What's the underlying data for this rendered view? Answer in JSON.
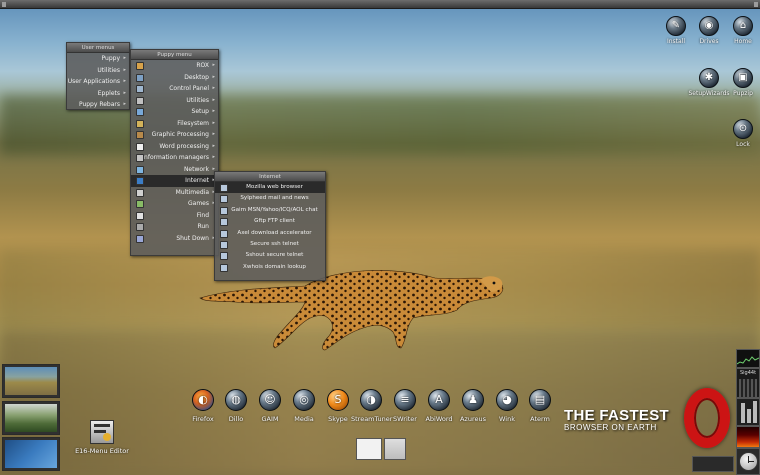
{
  "desktop": {
    "top_icons": [
      {
        "label": "Install",
        "icon": "install-icon",
        "glyph": "✎"
      },
      {
        "label": "Drives",
        "icon": "drives-icon",
        "glyph": "◉"
      },
      {
        "label": "Home",
        "icon": "home-icon",
        "glyph": "⌂"
      },
      {
        "label": "SetupWizards",
        "icon": "wizard-icon",
        "glyph": "✱"
      },
      {
        "label": "Pupzip",
        "icon": "pupzip-icon",
        "glyph": "▣"
      },
      {
        "label": "Lock",
        "icon": "lock-icon",
        "glyph": "⊙"
      }
    ],
    "menu_editor_label": "E16-Menu Editor"
  },
  "menus": {
    "user_menus": {
      "title": "User menus",
      "items": [
        "Puppy",
        "Utilities",
        "User Applications",
        "Epplets",
        "Puppy Rebars"
      ]
    },
    "puppy_menu": {
      "title": "Puppy menu",
      "items": [
        {
          "label": "ROX",
          "sub": true
        },
        {
          "label": "Desktop",
          "sub": true
        },
        {
          "label": "Control Panel",
          "sub": true
        },
        {
          "label": "Utilities",
          "sub": true
        },
        {
          "label": "Setup",
          "sub": true
        },
        {
          "label": "Filesystem",
          "sub": true
        },
        {
          "label": "Graphic Processing",
          "sub": true
        },
        {
          "label": "Word processing",
          "sub": true
        },
        {
          "label": "Information managers",
          "sub": true
        },
        {
          "label": "Network",
          "sub": true
        },
        {
          "label": "Internet",
          "sub": true
        },
        {
          "label": "Multimedia",
          "sub": true
        },
        {
          "label": "Games",
          "sub": true
        },
        {
          "label": "Find",
          "sub": false
        },
        {
          "label": "Run",
          "sub": false
        },
        {
          "label": "Shut Down",
          "sub": true
        }
      ]
    },
    "internet_menu": {
      "title": "Internet",
      "items": [
        "Mozilla web browser",
        "Sylpheed mail and news",
        "Gaim MSN/Yahoo/ICQ/AOL chat",
        "Gftp FTP client",
        "Axel download accelerator",
        "Secure ssh telnet",
        "Sshout secure telnet",
        "Xwhois domain lookup"
      ]
    }
  },
  "dock": {
    "items": [
      {
        "label": "Firefox",
        "icon": "firefox-icon",
        "glyph": "◐"
      },
      {
        "label": "Dillo",
        "icon": "dillo-icon",
        "glyph": "◍"
      },
      {
        "label": "GAIM",
        "icon": "gaim-icon",
        "glyph": "☺"
      },
      {
        "label": "Media",
        "icon": "media-icon",
        "glyph": "◎"
      },
      {
        "label": "Skype",
        "icon": "skype-icon",
        "glyph": "S"
      },
      {
        "label": "StreamTuner",
        "icon": "streamtuner-icon",
        "glyph": "◑"
      },
      {
        "label": "SWriter",
        "icon": "swriter-icon",
        "glyph": "≡"
      },
      {
        "label": "AbiWord",
        "icon": "abiword-icon",
        "glyph": "A"
      },
      {
        "label": "Azureus",
        "icon": "azureus-icon",
        "glyph": "♟"
      },
      {
        "label": "Wink",
        "icon": "wink-icon",
        "glyph": "◕"
      },
      {
        "label": "Aterm",
        "icon": "aterm-icon",
        "glyph": "▤"
      }
    ]
  },
  "opera_ad": {
    "line1": "THE FASTEST",
    "line2": "BROWSER ON EARTH"
  },
  "widgets": {
    "sig_label": "Sig44t",
    "colors": {
      "accent_red": "#cc1414",
      "menu_bg": "#5c5c5c"
    }
  }
}
